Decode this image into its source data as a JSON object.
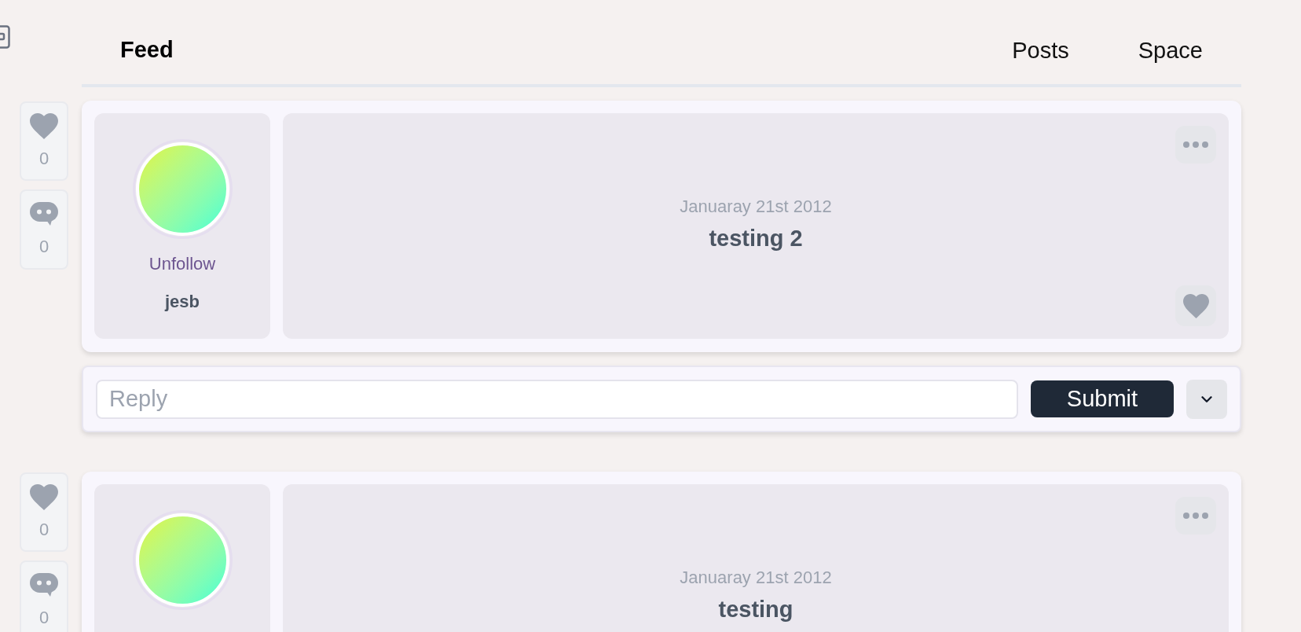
{
  "header": {
    "title": "Feed",
    "links": [
      "Posts",
      "Space"
    ]
  },
  "posts": [
    {
      "likes": "0",
      "comments": "0",
      "author": {
        "follow_label": "Unfollow",
        "name": "jesb"
      },
      "date": "Januaray 21st 2012",
      "title": "testing 2",
      "reply": {
        "placeholder": "Reply",
        "submit": "Submit"
      }
    },
    {
      "likes": "0",
      "comments": "0",
      "date": "Januaray 21st 2012",
      "title": "testing"
    }
  ]
}
